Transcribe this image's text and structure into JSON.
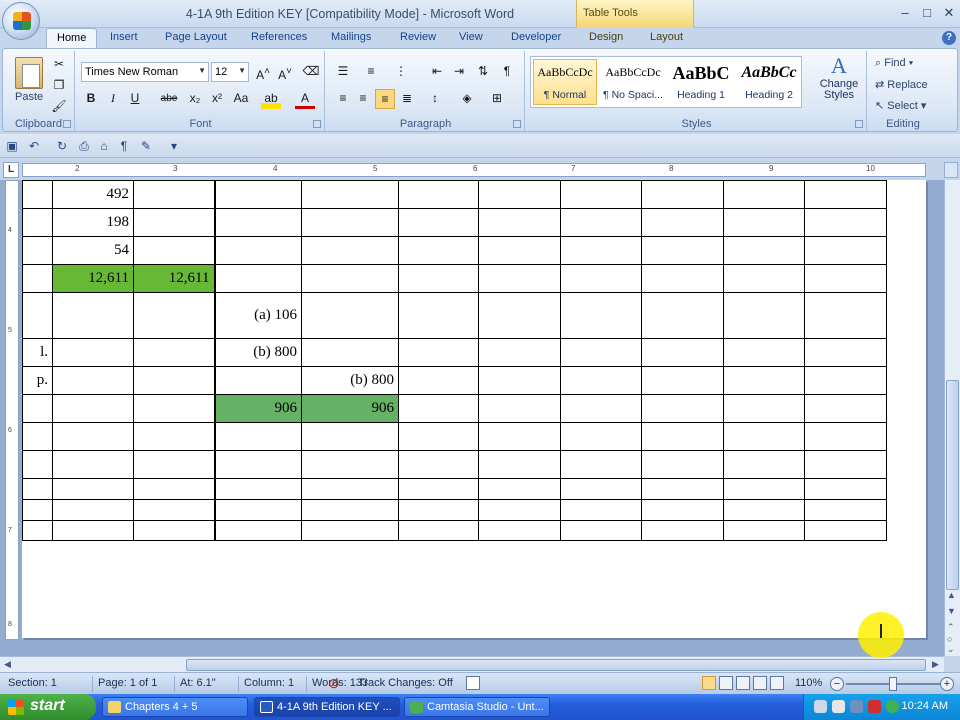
{
  "window": {
    "title": "4-1A 9th Edition KEY [Compatibility Mode] - Microsoft Word",
    "context_tab_group": "Table Tools",
    "controls": [
      "–",
      "□",
      "✕"
    ]
  },
  "ribbon_tabs": [
    "Home",
    "Insert",
    "Page Layout",
    "References",
    "Mailings",
    "Review",
    "View",
    "Developer",
    "Design",
    "Layout"
  ],
  "ribbon": {
    "clipboard": {
      "label": "Clipboard",
      "paste": "Paste"
    },
    "font": {
      "label": "Font",
      "font_name": "Times New Roman",
      "font_size": "12"
    },
    "paragraph": {
      "label": "Paragraph"
    },
    "styles": {
      "label": "Styles",
      "tiles": [
        {
          "sample": "AaBbCcDc",
          "name": "¶ Normal"
        },
        {
          "sample": "AaBbCcDc",
          "name": "¶ No Spaci..."
        },
        {
          "sample": "AaBbC",
          "name": "Heading 1"
        },
        {
          "sample": "AaBbCc",
          "name": "Heading 2"
        }
      ],
      "change_styles": [
        "Change",
        "Styles"
      ]
    },
    "editing": {
      "label": "Editing",
      "find": "Find",
      "replace": "Replace",
      "select": "Select"
    }
  },
  "ruler": {
    "ticks": [
      "2",
      "3",
      "4",
      "5",
      "6",
      "7",
      "8",
      "9",
      "10"
    ],
    "vticks": [
      "4",
      "5",
      "6",
      "7",
      "8"
    ]
  },
  "table": {
    "rows": [
      [
        "",
        "492",
        "",
        "",
        "",
        "",
        "",
        "",
        "",
        "",
        ""
      ],
      [
        "",
        "198",
        "",
        "",
        "",
        "",
        "",
        "",
        "",
        "",
        ""
      ],
      [
        "",
        "54",
        "",
        "",
        "",
        "",
        "",
        "",
        "",
        "",
        ""
      ],
      [
        "",
        "12,611",
        "12,611",
        "",
        "",
        "",
        "",
        "",
        "",
        "",
        ""
      ],
      [
        "",
        "",
        "",
        "(a) 106",
        "",
        "",
        "",
        "",
        "",
        "",
        ""
      ],
      [
        "l.",
        "",
        "",
        "(b) 800",
        "",
        "",
        "",
        "",
        "",
        "",
        ""
      ],
      [
        "p.",
        "",
        "",
        "",
        "(b) 800",
        "",
        "",
        "",
        "",
        "",
        ""
      ],
      [
        "",
        "",
        "",
        "906",
        "906",
        "",
        "",
        "",
        "",
        "",
        ""
      ],
      [
        "",
        "",
        "",
        "",
        "",
        "",
        "",
        "",
        "",
        "",
        ""
      ],
      [
        "",
        "",
        "",
        "",
        "",
        "",
        "",
        "",
        "",
        "",
        ""
      ],
      [
        "",
        "",
        "",
        "",
        "",
        "",
        "",
        "",
        "",
        "",
        ""
      ],
      [
        "",
        "",
        "",
        "",
        "",
        "",
        "",
        "",
        "",
        "",
        ""
      ],
      [
        "",
        "",
        "",
        "",
        "",
        "",
        "",
        "",
        "",
        "",
        ""
      ]
    ],
    "highlight_colors": {
      "total_green": "#66b835",
      "sum_green": "#65b166"
    }
  },
  "statusbar": {
    "section": "Section: 1",
    "page": "Page: 1 of 1",
    "at": "At: 6.1\"",
    "column": "Column: 1",
    "words": "Words: 133",
    "track_changes": "Track Changes: Off",
    "zoom": "110%"
  },
  "taskbar": {
    "start": "start",
    "tasks": [
      "Chapters 4 + 5",
      "4-1A 9th Edition KEY ...",
      "Camtasia Studio - Unt..."
    ],
    "clock": "10:24 AM"
  }
}
